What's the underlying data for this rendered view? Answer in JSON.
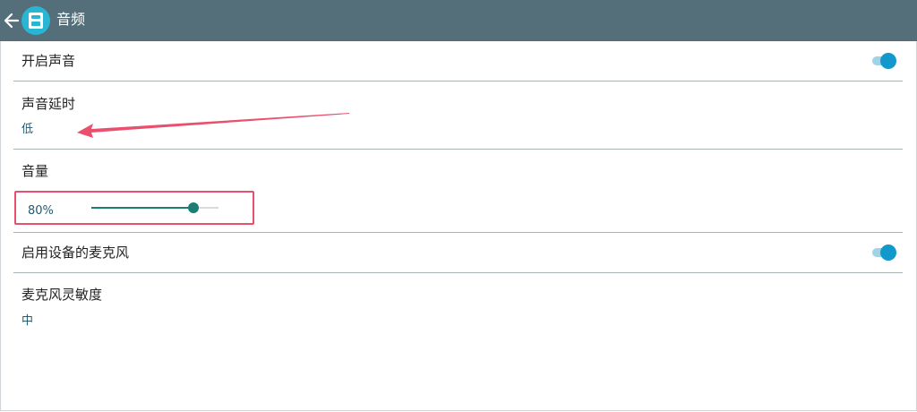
{
  "appbar": {
    "title": "音频",
    "back_icon": "arrow-left-icon",
    "app_icon": "app-logo-icon",
    "color": "#546e7a"
  },
  "settings": {
    "sound_enabled": {
      "label": "开启声音",
      "on": true
    },
    "sound_delay": {
      "label": "声音延时",
      "value": "低"
    },
    "volume": {
      "label": "音量",
      "value_text": "80%",
      "level": 0.8
    },
    "device_mic": {
      "label": "启用设备的麦克风",
      "on": true
    },
    "mic_sensitivity": {
      "label": "麦克风灵敏度",
      "value": "中"
    }
  },
  "colors": {
    "accent": "#1199cc",
    "slider": "#1c7d73",
    "annotation": "#e9506e"
  }
}
